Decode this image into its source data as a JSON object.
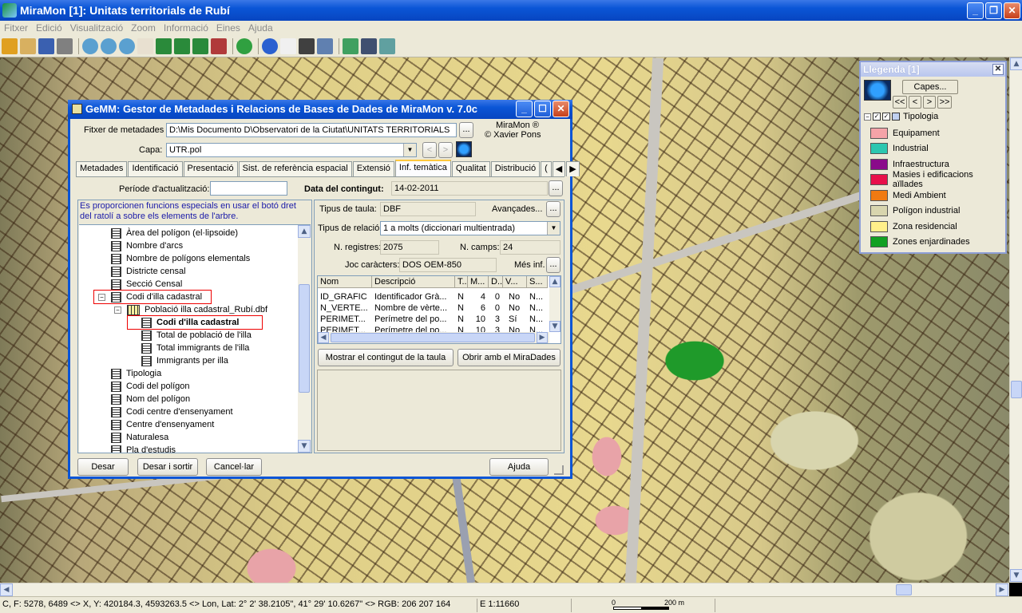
{
  "app": {
    "title": "MiraMon [1]:  Unitats territorials de Rubí"
  },
  "menu": [
    "Fitxer",
    "Edició",
    "Visualització",
    "Zoom",
    "Informació",
    "Eines",
    "Ajuda"
  ],
  "status": {
    "coords": "C, F: 5278, 6489 <> X, Y: 420184.3, 4593263.5 <> Lon, Lat: 2° 2' 38.2105\", 41° 29' 10.6267\" <> RGB:  206 207 164",
    "scale": "E 1:11660",
    "scalebar_start": "0",
    "scalebar_end": "200 m"
  },
  "legend": {
    "title": "Llegenda [1]",
    "capes_label": "Capes...",
    "nav": [
      "<<",
      "<",
      ">",
      ">>"
    ],
    "layer_name": "Tipologia",
    "items": [
      {
        "label": "Equipament",
        "color": "#f5a3a8"
      },
      {
        "label": "Industrial",
        "color": "#2cc7b0"
      },
      {
        "label": "Infraestructura",
        "color": "#8a0a8a"
      },
      {
        "label": "Masies i edificacions aïllades",
        "color": "#e8104a"
      },
      {
        "label": "Medi Ambient",
        "color": "#f07a12"
      },
      {
        "label": "Polígon industrial",
        "color": "#d8d5ae"
      },
      {
        "label": "Zona residencial",
        "color": "#fff08a"
      },
      {
        "label": "Zones enjardinades",
        "color": "#12a022"
      }
    ]
  },
  "gemm": {
    "title": "GeMM: Gestor de Metadades i Relacions de Bases de Dades de MiraMon v. 7.0c",
    "metadata_file_label": "Fitxer de metadades",
    "metadata_file_value": "D:\\Mis Documento D\\Observatori de la Ciutat\\UNITATS TERRITORIALS",
    "browse": "...",
    "author_line1": "MiraMon ®",
    "author_line2": "© Xavier Pons",
    "layer_label": "Capa:",
    "layer_value": "UTR.pol",
    "tabs": [
      "Metadades",
      "Identificació",
      "Presentació",
      "Sist. de referència espacial",
      "Extensió",
      "Inf. temàtica",
      "Qualitat",
      "Distribució",
      "("
    ],
    "period_label": "Període d'actualització:",
    "period_value": "",
    "date_label": "Data del contingut:",
    "date_value": "14-02-2011",
    "hint": "Es proporcionen funcions especials en usar el botó dret del ratolí a sobre els elements de l'arbre.",
    "tree": [
      {
        "label": "Àrea del polígon (el·lipsoide)",
        "level": 1
      },
      {
        "label": "Nombre d'arcs",
        "level": 1
      },
      {
        "label": "Nombre de polígons elementals",
        "level": 1
      },
      {
        "label": "Districte censal",
        "level": 1
      },
      {
        "label": "Secció Censal",
        "level": 1
      },
      {
        "label": "Codi d'illa cadastral",
        "level": 1,
        "expanded": "−"
      },
      {
        "label": "Població illa cadastral_Rubí.dbf",
        "level": 2,
        "expanded": "−"
      },
      {
        "label": "Codi d'illa cadastral",
        "level": 3,
        "bold": true
      },
      {
        "label": "Total de població de l'illa",
        "level": 3
      },
      {
        "label": "Total immigrants de l'illa",
        "level": 3
      },
      {
        "label": "Immigrants per illa",
        "level": 3
      },
      {
        "label": "Tipologia",
        "level": 1
      },
      {
        "label": "Codi del polígon",
        "level": 1
      },
      {
        "label": "Nom del polígon",
        "level": 1
      },
      {
        "label": "Codi centre d'ensenyament",
        "level": 1
      },
      {
        "label": "Centre d'ensenyament",
        "level": 1
      },
      {
        "label": "Naturalesa",
        "level": 1
      },
      {
        "label": "Pla d'estudis",
        "level": 1
      }
    ],
    "table_type_label": "Tipus de taula:",
    "table_type_value": "DBF",
    "advanced_label": "Avançades...",
    "relation_label": "Tipus de relació:",
    "relation_value": "1 a molts (diccionari multientrada)",
    "records_label": "N. registres:",
    "records_value": "2075",
    "fields_label": "N. camps:",
    "fields_value": "24",
    "charset_label": "Joc caràcters:",
    "charset_value": "DOS OEM-850",
    "more_info_label": "Més inf.",
    "grid_headers": [
      "Nom",
      "Descripció",
      "T..",
      "M...",
      "D..",
      "V...",
      "S..."
    ],
    "grid_rows": [
      [
        "ID_GRAFIC",
        "Identificador Grà...",
        "N",
        "4",
        "0",
        "No",
        "N..."
      ],
      [
        "N_VERTE...",
        "Nombre de vèrte...",
        "N",
        "6",
        "0",
        "No",
        "N..."
      ],
      [
        "PERIMET...",
        "Perímetre del po...",
        "N",
        "10",
        "3",
        "Sí",
        "N..."
      ],
      [
        "PERIMET...",
        "Perímetre del po...",
        "N",
        "10",
        "3",
        "No",
        "N..."
      ]
    ],
    "show_table_label": "Mostrar el contingut de la taula",
    "open_miradades_label": "Obrir amb el MiraDades",
    "save_label": "Desar",
    "save_exit_label": "Desar i sortir",
    "cancel_label": "Cancel·lar",
    "help_label": "Ajuda"
  }
}
